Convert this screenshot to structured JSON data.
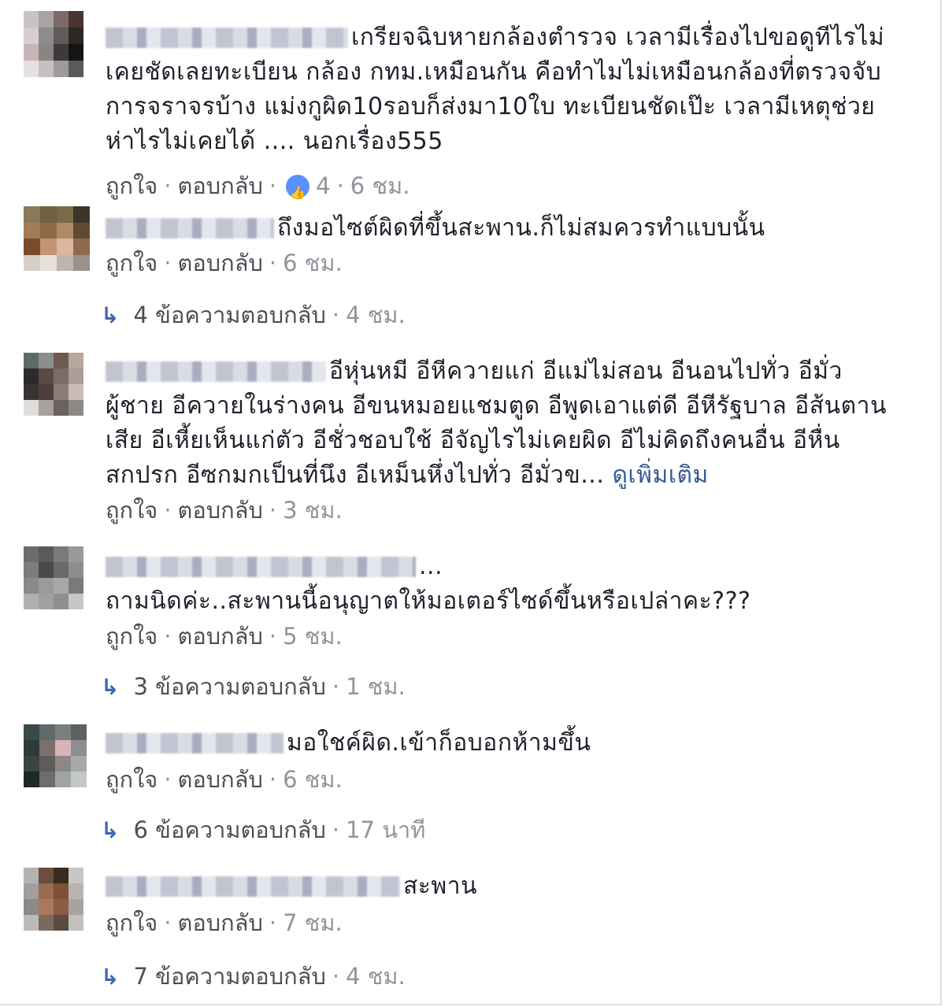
{
  "comments": [
    {
      "text": "เกรียจฉิบหายกล้องตำรวจ เวลามีเรื่องไปขอดูทีไรไม่เคยชัดเลยทะเบียน กล้อง กทม.เหมือนกัน คือทำไมไม่เหมือนกล้องที่ตรวจจับการจราจรบ้าง แม่งกูผิด10รอบก็ส่งมา10ใบ ทะเบียนชัดเป๊ะ เวลามีเหตุช่วยห่าไรไม่เคยได้ .... นอกเรื่อง555",
      "like_label": "ถูกใจ",
      "reply_label": "ตอบกลับ",
      "reaction_count": "4",
      "time": "6 ชม.",
      "avatar": [
        "#c9c2c2",
        "#a9a3a3",
        "#7d6a66",
        "#4a3330",
        "#d6cfcf",
        "#8d8c8c",
        "#5e5b5a",
        "#2a2725",
        "#c8b3b6",
        "#8a8584",
        "#3d3b3a",
        "#131513",
        "#e6e1e1",
        "#c5c1c1",
        "#9e9a9a",
        "#5c5a59"
      ]
    },
    {
      "text": "ถึงมอไซต์ผิดที่ขึ้นสะพาน.ก็ไม่สมควรทำแบบนั้น",
      "like_label": "ถูกใจ",
      "reply_label": "ตอบกลับ",
      "time": "6 ชม.",
      "replies_count_text": "4 ข้อความตอบกลับ",
      "replies_time": "4 ชม.",
      "avatar": [
        "#8a7a5a",
        "#6e6040",
        "#7a6a48",
        "#3d3528",
        "#a27b58",
        "#8f6a49",
        "#b08a66",
        "#5e4a30",
        "#7a4a2d",
        "#c59478",
        "#d8b6a0",
        "#8f6a4f",
        "#d5cfc8",
        "#e7e0db",
        "#bfb5ad",
        "#9b9189"
      ]
    },
    {
      "text": "อีหุ่นหมี อีหีควายแก่ อีแม่ไม่สอน อีนอนไปทั่ว อีมั่วผู้ชาย อีควายในร่างคน อีขนหมอยแชมตูด อีพูดเอาแต่ดี อีหีรัฐบาล อีส้นตานเสีย อีเหี้ยเห็นแก่ตัว อีชั่วชอบใช้ อีจัญไรไม่เคยผิด อีไม่คิดถึงคนอื่น อีหื่นสกปรก อีซกมกเป็นที่นึง อีเหม็นหึ่งไปทั่ว อีมั่วข...",
      "see_more": "ดูเพิ่มเติม",
      "like_label": "ถูกใจ",
      "reply_label": "ตอบกลับ",
      "time": "3 ชม.",
      "avatar": [
        "#5d6a6a",
        "#8a8e8c",
        "#6e5a50",
        "#b7a79f",
        "#2e2a2a",
        "#5a4a44",
        "#7a6d68",
        "#a99d98",
        "#3a3333",
        "#4c3e3a",
        "#8c7c76",
        "#c9bdb8",
        "#e0dcda",
        "#a8a09c",
        "#6b625f",
        "#8d8986"
      ]
    },
    {
      "text": "ถามนิดค่ะ..สะพานนี้อนุญาตให้มอเตอร์ไซด์ขึ้นหรือเปล่าคะ???",
      "name_suffix": "...",
      "like_label": "ถูกใจ",
      "reply_label": "ตอบกลับ",
      "time": "5 ชม.",
      "replies_count_text": "3 ข้อความตอบกลับ",
      "replies_time": "1 ชม.",
      "avatar": [
        "#6c6c6c",
        "#5a5a5a",
        "#7a7a7a",
        "#9a9a9a",
        "#7d7d7d",
        "#4a4a4a",
        "#6a6a6a",
        "#8d8d8d",
        "#8a8a8a",
        "#9b9b9b",
        "#a8a8a8",
        "#7a7a7a",
        "#b0b0b0",
        "#a0a0a0",
        "#8f8f8f",
        "#c6c6c6"
      ]
    },
    {
      "text": "มอใชค์ผิด.เข้าก็อบอกห้ามขึ้น",
      "like_label": "ถูกใจ",
      "reply_label": "ตอบกลับ",
      "time": "6 ชม.",
      "replies_count_text": "6 ข้อความตอบกลับ",
      "replies_time": "17 นาที",
      "avatar": [
        "#3a4a4a",
        "#606a6a",
        "#7b7f80",
        "#5c6263",
        "#2f3a3a",
        "#7d6f70",
        "#d9b3b5",
        "#8c8f90",
        "#3b4444",
        "#5f5a5c",
        "#8e8788",
        "#a7aaab",
        "#1f2727",
        "#6c6e6e",
        "#9fa3a4",
        "#c4c7c8"
      ]
    },
    {
      "text": "สะพาน",
      "like_label": "ถูกใจ",
      "reply_label": "ตอบกลับ",
      "time": "7 ชม.",
      "replies_count_text": "7 ข้อความตอบกลับ",
      "replies_time": "4 ชม.",
      "avatar": [
        "#b6b2b0",
        "#6a4e3e",
        "#3b2a20",
        "#c9c6c4",
        "#a19e9c",
        "#9a6b4e",
        "#7d5038",
        "#b8b4b2",
        "#8c8987",
        "#a87a5c",
        "#8a5c42",
        "#a6a3a1",
        "#bcb9b7",
        "#7a6a5e",
        "#5a4a40",
        "#c2bfbd"
      ]
    }
  ],
  "colors": {
    "link": "#385898",
    "meta": "#90949c",
    "like_badge": "#5890ff",
    "reply_arrow": "#4267b2"
  },
  "icons": {
    "reaction": "like-reaction-icon",
    "reply": "reply-arrow-icon"
  }
}
